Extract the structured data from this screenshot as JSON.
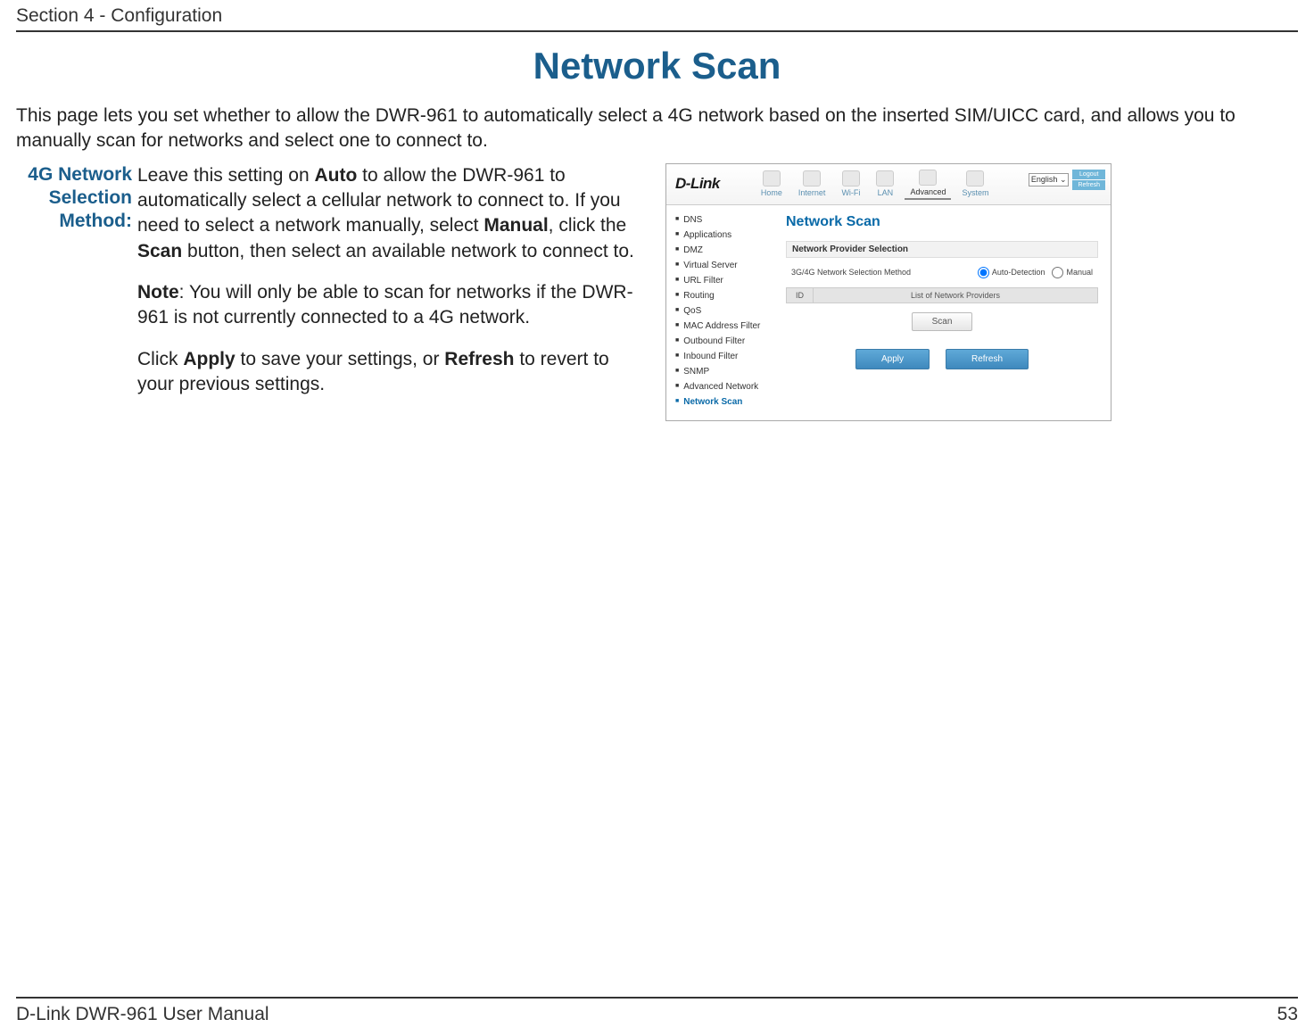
{
  "header": {
    "section": "Section 4 - Configuration"
  },
  "title": "Network Scan",
  "intro": "This page lets you set whether to allow the DWR-961 to automatically select a 4G network based on the inserted SIM/UICC card, and allows you to manually scan for networks and select one to connect to.",
  "field": {
    "label_l1": "4G Network",
    "label_l2": "Selection",
    "label_l3": "Method:",
    "p1_a": "Leave this setting on ",
    "p1_b": "Auto",
    "p1_c": " to allow the DWR-961 to automatically select a cellular network to connect to. If you need to select a network manually, select ",
    "p1_d": "Manual",
    "p1_e": ", click the ",
    "p1_f": "Scan",
    "p1_g": " button, then select an available network to connect to.",
    "p2_a": "Note",
    "p2_b": ": You will only be able to scan for networks if the DWR-961 is not currently connected to a 4G network.",
    "p3_a": "Click ",
    "p3_b": "Apply",
    "p3_c": " to save your settings, or ",
    "p3_d": "Refresh",
    "p3_e": " to revert to your previous settings."
  },
  "ui": {
    "logo": "D-Link",
    "lang": "English",
    "corner": {
      "logout": "Logout",
      "refresh": "Refresh"
    },
    "nav": {
      "home": "Home",
      "internet": "Internet",
      "wifi": "Wi-Fi",
      "lan": "LAN",
      "advanced": "Advanced",
      "system": "System"
    },
    "sidebar": [
      "DNS",
      "Applications",
      "DMZ",
      "Virtual Server",
      "URL Filter",
      "Routing",
      "QoS",
      "MAC Address Filter",
      "Outbound Filter",
      "Inbound Filter",
      "SNMP",
      "Advanced Network",
      "Network Scan"
    ],
    "content": {
      "heading": "Network Scan",
      "section_label": "Network Provider Selection",
      "row_label": "3G/4G Network Selection Method",
      "radio_auto": "Auto-Detection",
      "radio_manual": "Manual",
      "col_id": "ID",
      "col_list": "List of Network Providers",
      "scan_btn": "Scan",
      "apply_btn": "Apply",
      "refresh_btn": "Refresh"
    }
  },
  "footer": {
    "left": "D-Link DWR-961 User Manual",
    "right": "53"
  }
}
